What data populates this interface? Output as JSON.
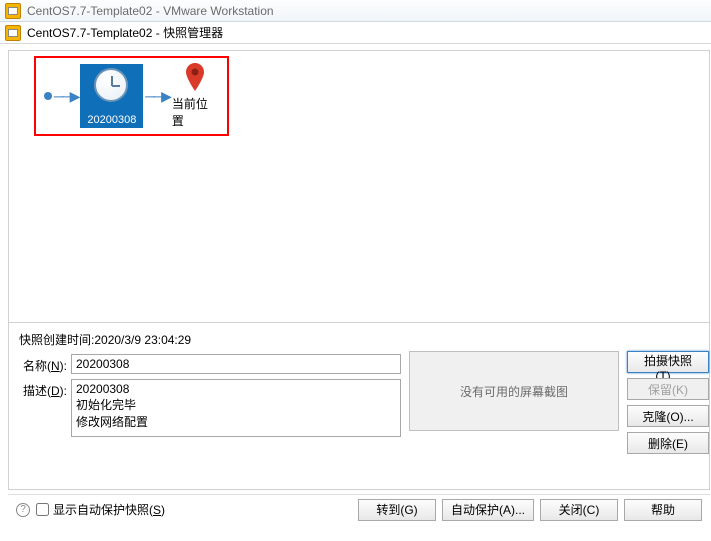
{
  "window": {
    "title": "CentOS7.7-Template02 - VMware Workstation",
    "sub_title": "CentOS7.7-Template02 - 快照管理器"
  },
  "canvas": {
    "snapshot_label": "20200308",
    "here_label": "当前位置"
  },
  "details": {
    "created_label": "快照创建时间:",
    "created_value": "2020/3/9 23:04:29",
    "name_label": "名称(",
    "name_key": "N",
    "name_suffix": "):",
    "name_value": "20200308",
    "desc_label": "描述(",
    "desc_key": "D",
    "desc_suffix": "):",
    "desc_value": "20200308\n初始化完毕\n修改网络配置",
    "no_screenshot": "没有可用的屏幕截图"
  },
  "side_buttons": {
    "take": "拍摄快照(T)...",
    "keep": "保留(K)",
    "clone": "克隆(O)...",
    "delete": "删除(E)"
  },
  "bottom": {
    "checkbox_label": "显示自动保护快照(",
    "checkbox_key": "S",
    "checkbox_suffix": ")",
    "goto": "转到(G)",
    "autoprotect": "自动保护(A)...",
    "close": "关闭(C)",
    "help": "帮助"
  }
}
